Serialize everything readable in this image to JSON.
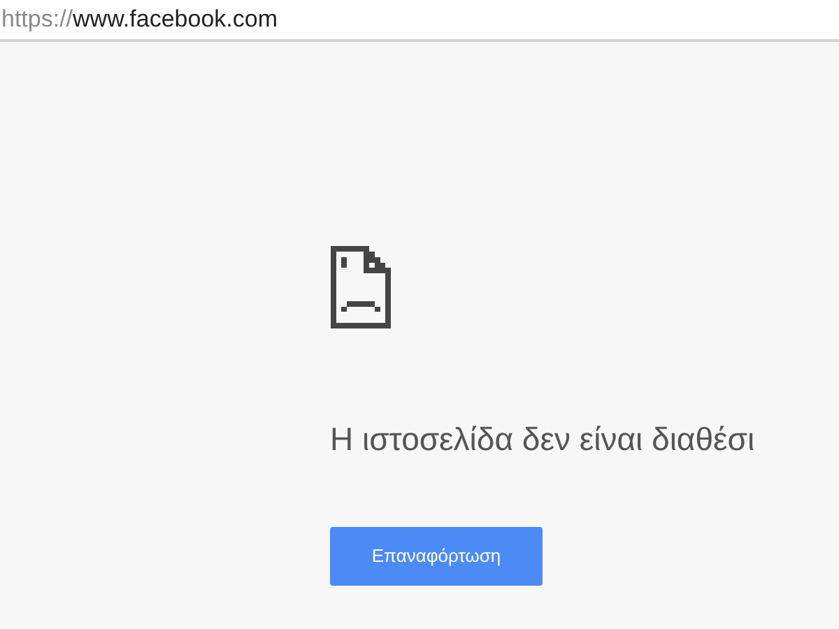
{
  "address_bar": {
    "scheme": "https://",
    "host": "www.facebook.com"
  },
  "error": {
    "heading": "Η ιστοσελίδα δεν είναι διαθέσι",
    "button": "Επαναφόρτωση"
  }
}
